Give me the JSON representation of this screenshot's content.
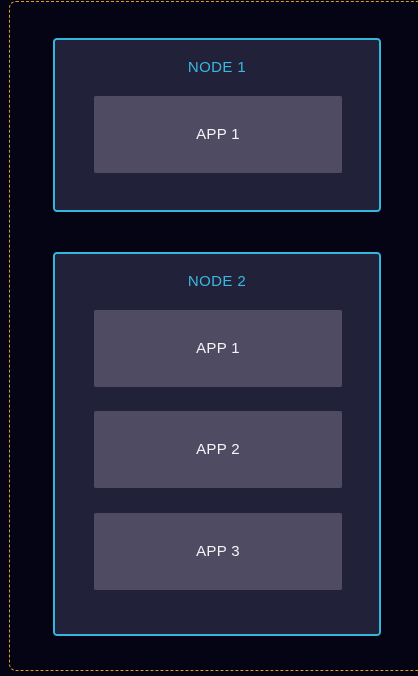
{
  "colors": {
    "background": "#050414",
    "cluster_border": "#d9a21b",
    "node_border": "#35b6dc",
    "node_fill": "#22213a",
    "node_title": "#3ab8e0",
    "app_fill": "#4f4b62",
    "app_text": "#f4f3f8"
  },
  "nodes": [
    {
      "title": "NODE 1",
      "apps": [
        "APP 1"
      ]
    },
    {
      "title": "NODE 2",
      "apps": [
        "APP 1",
        "APP 2",
        "APP 3"
      ]
    }
  ]
}
